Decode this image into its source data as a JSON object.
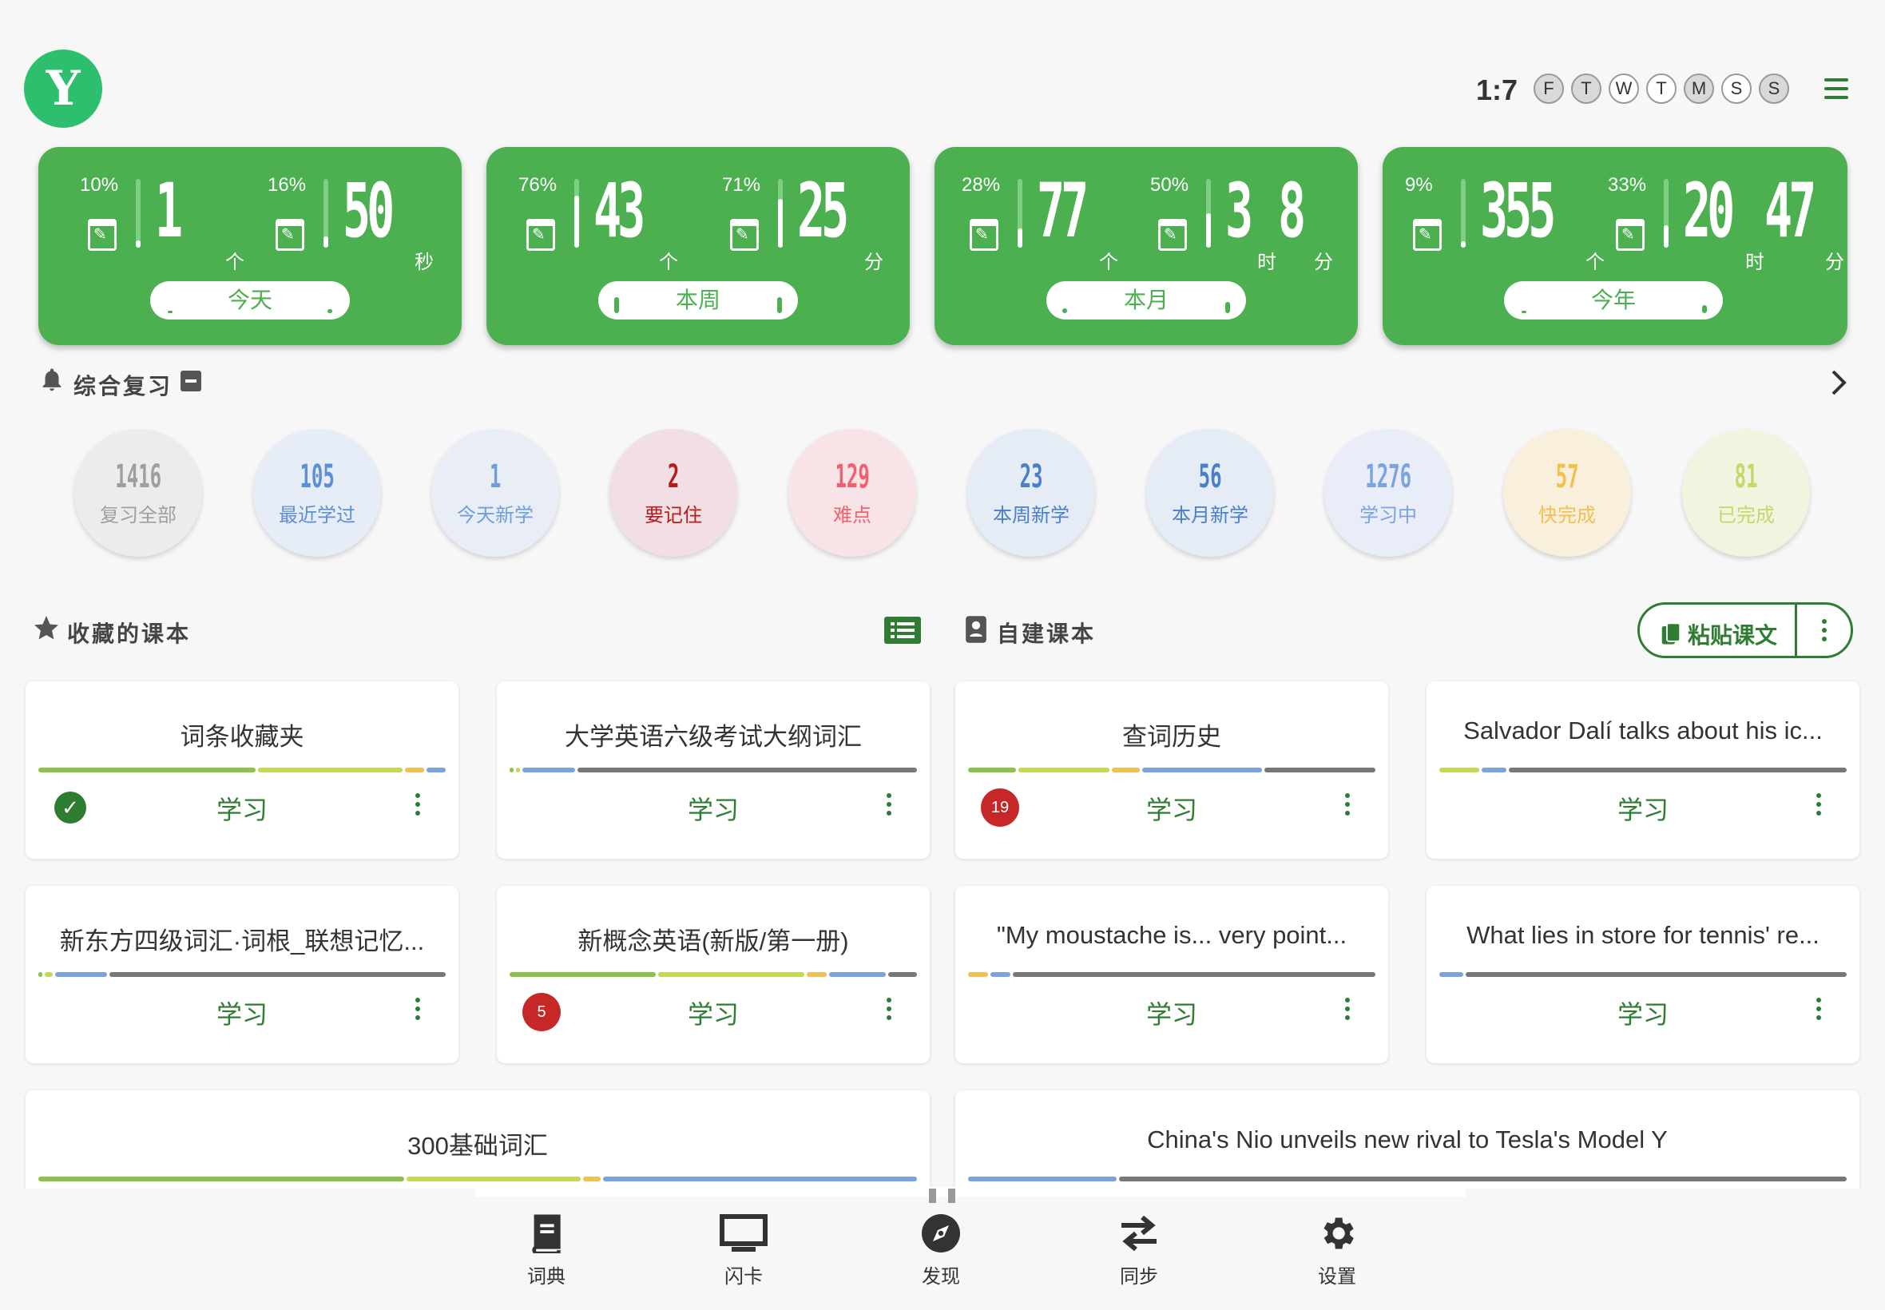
{
  "header": {
    "logo": "Y",
    "ratio": "1:7",
    "days": [
      "F",
      "T",
      "W",
      "T",
      "M",
      "S",
      "S"
    ]
  },
  "stats": [
    {
      "pill": "今天",
      "a_pct": "10%",
      "a_num": "1",
      "a_unit": "个",
      "b_pct": "16%",
      "b_num": "50",
      "b_unit": "秒",
      "a_fill": 0.1,
      "b_fill": 0.16
    },
    {
      "pill": "本周",
      "a_pct": "76%",
      "a_num": "43",
      "a_unit": "个",
      "b_pct": "71%",
      "b_num": "25",
      "b_unit": "分",
      "a_fill": 0.76,
      "b_fill": 0.71
    },
    {
      "pill": "本月",
      "a_pct": "28%",
      "a_num": "77",
      "a_unit": "个",
      "b_pct": "50%",
      "b_num": "3",
      "b_mid": "时",
      "b_num2": "8",
      "b_unit": "分",
      "a_fill": 0.28,
      "b_fill": 0.5
    },
    {
      "pill": "今年",
      "a_pct": "9%",
      "a_num": "355",
      "a_unit": "个",
      "b_pct": "33%",
      "b_num": "20",
      "b_mid": "时",
      "b_num2": "47",
      "b_unit": "分",
      "a_fill": 0.09,
      "b_fill": 0.33
    }
  ],
  "review": {
    "title": "综合复习"
  },
  "circles": [
    {
      "num": "1416",
      "label": "复习全部",
      "color": "#9e9e9e",
      "bg": "#ececec"
    },
    {
      "num": "105",
      "label": "最近学过",
      "color": "#5c8fd6",
      "bg": "#e6edf7"
    },
    {
      "num": "1",
      "label": "今天新学",
      "color": "#6e9fdc",
      "bg": "#e9eef6"
    },
    {
      "num": "2",
      "label": "要记住",
      "color": "#b71c1c",
      "bg": "#f1dfe3"
    },
    {
      "num": "129",
      "label": "难点",
      "color": "#f06070",
      "bg": "#f8e3e6"
    },
    {
      "num": "23",
      "label": "本周新学",
      "color": "#4a7fc9",
      "bg": "#e5ecf5"
    },
    {
      "num": "56",
      "label": "本月新学",
      "color": "#4a7fc9",
      "bg": "#e5ecf5"
    },
    {
      "num": "1276",
      "label": "学习中",
      "color": "#7aa3e0",
      "bg": "#e8edf8"
    },
    {
      "num": "57",
      "label": "快完成",
      "color": "#f0c050",
      "bg": "#f8f0dc"
    },
    {
      "num": "81",
      "label": "已完成",
      "color": "#c5d86a",
      "bg": "#f1f4df"
    }
  ],
  "lessons": {
    "fav_title": "收藏的课本",
    "own_title": "自建课本",
    "paste_label": "粘贴课文"
  },
  "cards": [
    {
      "title": "词条收藏夹",
      "study": "学习",
      "badge": "",
      "check": true
    },
    {
      "title": "大学英语六级考试大纲词汇",
      "study": "学习",
      "badge": ""
    },
    {
      "title": "查词历史",
      "study": "学习",
      "badge": "19"
    },
    {
      "title": "Salvador Dalí talks about his ic...",
      "study": "学习",
      "badge": ""
    },
    {
      "title": "新东方四级词汇·词根_联想记忆...",
      "study": "学习",
      "badge": ""
    },
    {
      "title": "新概念英语(新版/第一册)",
      "study": "学习",
      "badge": "5"
    },
    {
      "title": "\"My moustache is... very point...",
      "study": "学习",
      "badge": ""
    },
    {
      "title": "What lies in store for tennis' re...",
      "study": "学习",
      "badge": ""
    },
    {
      "title": "300基础词汇",
      "study": "",
      "badge": ""
    },
    {
      "title": "China's Nio unveils new rival to Tesla's Model Y",
      "study": "",
      "badge": ""
    }
  ],
  "nav": [
    {
      "label": "词典",
      "icon": "book-icon"
    },
    {
      "label": "闪卡",
      "icon": "monitor-icon"
    },
    {
      "label": "发现",
      "icon": "compass-icon"
    },
    {
      "label": "同步",
      "icon": "sync-icon"
    },
    {
      "label": "设置",
      "icon": "gear-icon"
    }
  ]
}
